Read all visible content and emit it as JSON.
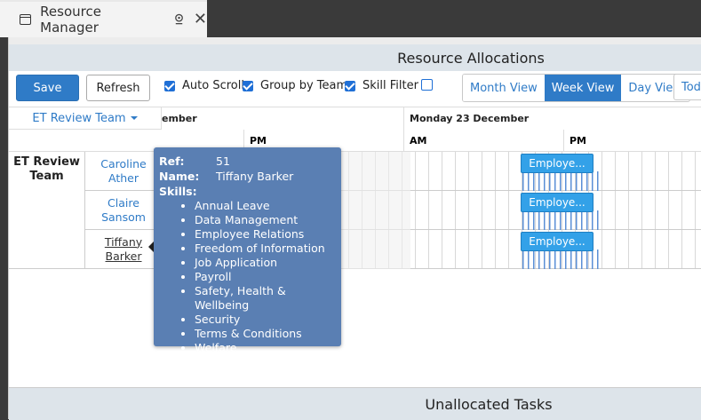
{
  "tab": {
    "title": "Resource Manager"
  },
  "header": {
    "title": "Resource Allocations"
  },
  "toolbar": {
    "save_label": "Save",
    "refresh_label": "Refresh",
    "checkboxes": [
      {
        "label": "Auto Scroll",
        "checked": true
      },
      {
        "label": "Group by Team",
        "checked": true
      },
      {
        "label": "Skill Filter",
        "checked": true
      },
      {
        "label": "",
        "checked": false
      }
    ],
    "views": [
      "Month View",
      "Week View",
      "Day View"
    ],
    "active_view": "Week View",
    "today_label": "Toda"
  },
  "grid": {
    "team_dropdown": "ET Review Team",
    "date_headers": [
      "ember",
      "Monday 23 December"
    ],
    "period_headers": [
      "PM",
      "AM",
      "PM"
    ],
    "team": "ET Review Team",
    "people": [
      {
        "name": "Caroline Ather",
        "task": "Employe..."
      },
      {
        "name": "Claire Sansom",
        "task": "Employe..."
      },
      {
        "name": "Tiffany Barker",
        "task": "Employe..."
      }
    ]
  },
  "tooltip": {
    "ref_label": "Ref:",
    "ref_value": "51",
    "name_label": "Name:",
    "name_value": "Tiffany Barker",
    "skills_label": "Skills:",
    "skills": [
      "Annual Leave",
      "Data Management",
      "Employee Relations",
      "Freedom of Information",
      "Job Application",
      "Payroll",
      "Safety, Health & Wellbeing",
      "Security",
      "Terms & Conditions",
      "Welfare"
    ]
  },
  "footer": {
    "title": "Unallocated Tasks"
  },
  "colors": {
    "primary": "#2f7bc7",
    "task": "#33a1e8",
    "tooltip": "#5a7fb3"
  }
}
